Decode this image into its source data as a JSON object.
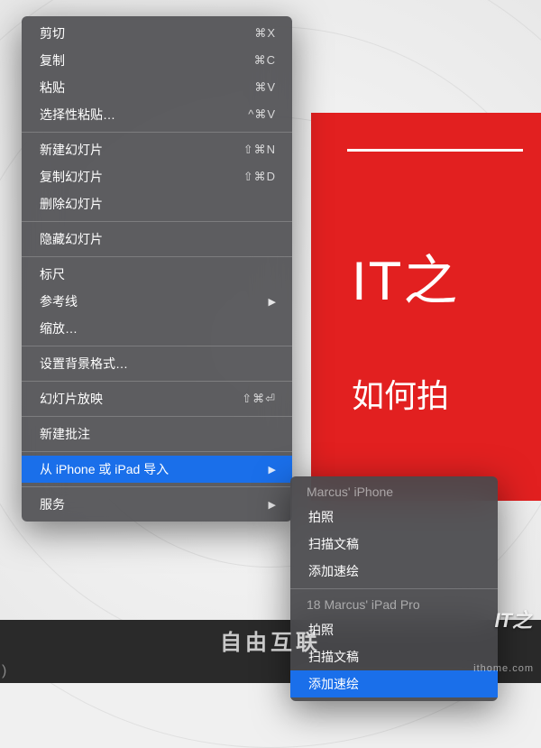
{
  "slide": {
    "title": "IT之",
    "subtitle": "如何拍"
  },
  "menu": {
    "cut": {
      "label": "剪切",
      "shortcut": "⌘X"
    },
    "copy": {
      "label": "复制",
      "shortcut": "⌘C"
    },
    "paste": {
      "label": "粘贴",
      "shortcut": "⌘V"
    },
    "paste_special": {
      "label": "选择性粘贴…",
      "shortcut": "^⌘V"
    },
    "new_slide": {
      "label": "新建幻灯片",
      "shortcut": "⇧⌘N"
    },
    "duplicate_slide": {
      "label": "复制幻灯片",
      "shortcut": "⇧⌘D"
    },
    "delete_slide": {
      "label": "删除幻灯片",
      "shortcut": ""
    },
    "hide_slide": {
      "label": "隐藏幻灯片",
      "shortcut": ""
    },
    "ruler": {
      "label": "标尺",
      "shortcut": ""
    },
    "guides": {
      "label": "参考线",
      "shortcut": ""
    },
    "zoom": {
      "label": "缩放…",
      "shortcut": ""
    },
    "background_format": {
      "label": "设置背景格式…",
      "shortcut": ""
    },
    "slideshow": {
      "label": "幻灯片放映",
      "shortcut": "⇧⌘⏎"
    },
    "new_comment": {
      "label": "新建批注",
      "shortcut": ""
    },
    "import_from_device": {
      "label": "从 iPhone 或 iPad 导入",
      "shortcut": ""
    },
    "services": {
      "label": "服务",
      "shortcut": ""
    }
  },
  "submenu": {
    "device1": "Marcus' iPhone",
    "device2": "18 Marcus' iPad Pro",
    "take_photo": "拍照",
    "scan_doc": "扫描文稿",
    "add_sketch": "添加速绘"
  },
  "watermarks": {
    "brand": "IT之",
    "site": "ithome.com",
    "center": "自由互联"
  },
  "footer": {
    "paren": ")"
  }
}
